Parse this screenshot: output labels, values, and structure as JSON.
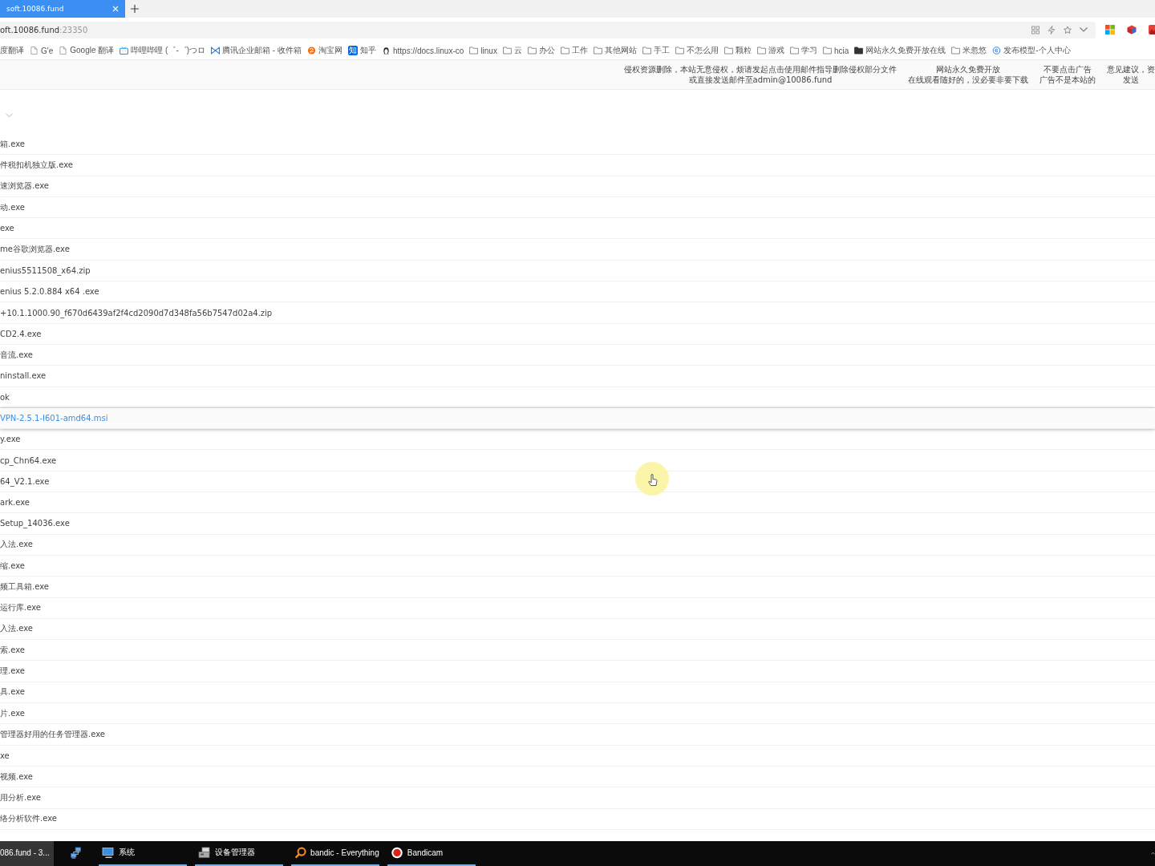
{
  "browser": {
    "tabs": [
      {
        "title": "soft.10086.fund",
        "selected": true
      }
    ],
    "address": {
      "host": "oft.10086.fund",
      "port": ":23350"
    },
    "bookmarks": [
      {
        "label": "度翻译",
        "kind": "none"
      },
      {
        "label": "G'e",
        "kind": "page"
      },
      {
        "label": "Google 翻译",
        "kind": "page"
      },
      {
        "label": "哔哩哔哩 (゜-゜)つロ",
        "kind": "tv"
      },
      {
        "label": "腾讯企业邮箱 - 收件箱",
        "kind": "mail"
      },
      {
        "label": "淘宝网",
        "kind": "shop"
      },
      {
        "label": "知乎",
        "kind": "badge",
        "badge": "知"
      },
      {
        "label": "https://docs.linux-co",
        "kind": "penguin"
      },
      {
        "label": "linux",
        "kind": "folder"
      },
      {
        "label": "云",
        "kind": "folder"
      },
      {
        "label": "办公",
        "kind": "folder"
      },
      {
        "label": "工作",
        "kind": "folder"
      },
      {
        "label": "其他网站",
        "kind": "folder"
      },
      {
        "label": "手工",
        "kind": "folder"
      },
      {
        "label": "不怎么用",
        "kind": "folder"
      },
      {
        "label": "颗粒",
        "kind": "folder"
      },
      {
        "label": "游戏",
        "kind": "folder"
      },
      {
        "label": "学习",
        "kind": "folder"
      },
      {
        "label": "hcia",
        "kind": "folder"
      },
      {
        "label": "网站永久免费开放在线",
        "kind": "folder-filled"
      },
      {
        "label": "米忽悠",
        "kind": "folder"
      },
      {
        "label": "发布模型-个人中心",
        "kind": "ring"
      }
    ]
  },
  "notices": [
    {
      "lines": [
        "侵权资源删除，本站无意侵权，烦请发起点击使用邮件指导删除侵权部分文件",
        "或直接发送邮件至admin@10086.fund"
      ]
    },
    {
      "lines": [
        "网站永久免费开放",
        "在线观看随好的，没必要非要下载"
      ]
    },
    {
      "lines": [
        "不要点击广告",
        "广告不是本站的"
      ]
    },
    {
      "lines": [
        "意见建议，资",
        "发送"
      ]
    }
  ],
  "files": [
    {
      "name": "箱.exe",
      "hovered": false
    },
    {
      "name": "件税扣机独立版.exe",
      "hovered": false
    },
    {
      "name": "速浏览器.exe",
      "hovered": false
    },
    {
      "name": "动.exe",
      "hovered": false
    },
    {
      "name": "exe",
      "hovered": false
    },
    {
      "name": "me谷歌浏览器.exe",
      "hovered": false
    },
    {
      "name": "enius5511508_x64.zip",
      "hovered": false
    },
    {
      "name": "enius 5.2.0.884 x64 .exe",
      "hovered": false
    },
    {
      "name": "+10.1.1000.90_f670d6439af2f4cd2090d7d348fa56b7547d02a4.zip",
      "hovered": false
    },
    {
      "name": "CD2.4.exe",
      "hovered": false
    },
    {
      "name": "音流.exe",
      "hovered": false
    },
    {
      "name": "ninstall.exe",
      "hovered": false
    },
    {
      "name": "ok",
      "hovered": false
    },
    {
      "name": "VPN-2.5.1-I601-amd64.msi",
      "hovered": true
    },
    {
      "name": "y.exe",
      "hovered": false
    },
    {
      "name": "cp_Chn64.exe",
      "hovered": false
    },
    {
      "name": "64_V2.1.exe",
      "hovered": false
    },
    {
      "name": "ark.exe",
      "hovered": false
    },
    {
      "name": "Setup_14036.exe",
      "hovered": false
    },
    {
      "name": "入法.exe",
      "hovered": false
    },
    {
      "name": "缩.exe",
      "hovered": false
    },
    {
      "name": "频工具箱.exe",
      "hovered": false
    },
    {
      "name": "运行库.exe",
      "hovered": false
    },
    {
      "name": "入法.exe",
      "hovered": false
    },
    {
      "name": "索.exe",
      "hovered": false
    },
    {
      "name": "理.exe",
      "hovered": false
    },
    {
      "name": "具.exe",
      "hovered": false
    },
    {
      "name": "片.exe",
      "hovered": false
    },
    {
      "name": "管理器好用的任务管理器.exe",
      "hovered": false
    },
    {
      "name": "xe",
      "hovered": false
    },
    {
      "name": "视频.exe",
      "hovered": false
    },
    {
      "name": "用分析.exe",
      "hovered": false
    },
    {
      "name": "络分析软件.exe",
      "hovered": false
    }
  ],
  "taskbar": [
    {
      "label": "086.fund - 3...",
      "kind": "plain",
      "selected": true
    },
    {
      "kind": "network",
      "selected": false
    },
    {
      "label": "系统",
      "kind": "computer",
      "selected": false
    },
    {
      "label": "设备管理器",
      "kind": "devices",
      "selected": false
    },
    {
      "label": "bandic - Everything",
      "kind": "search",
      "selected": false
    },
    {
      "label": "Bandicam",
      "kind": "record",
      "selected": false
    }
  ]
}
